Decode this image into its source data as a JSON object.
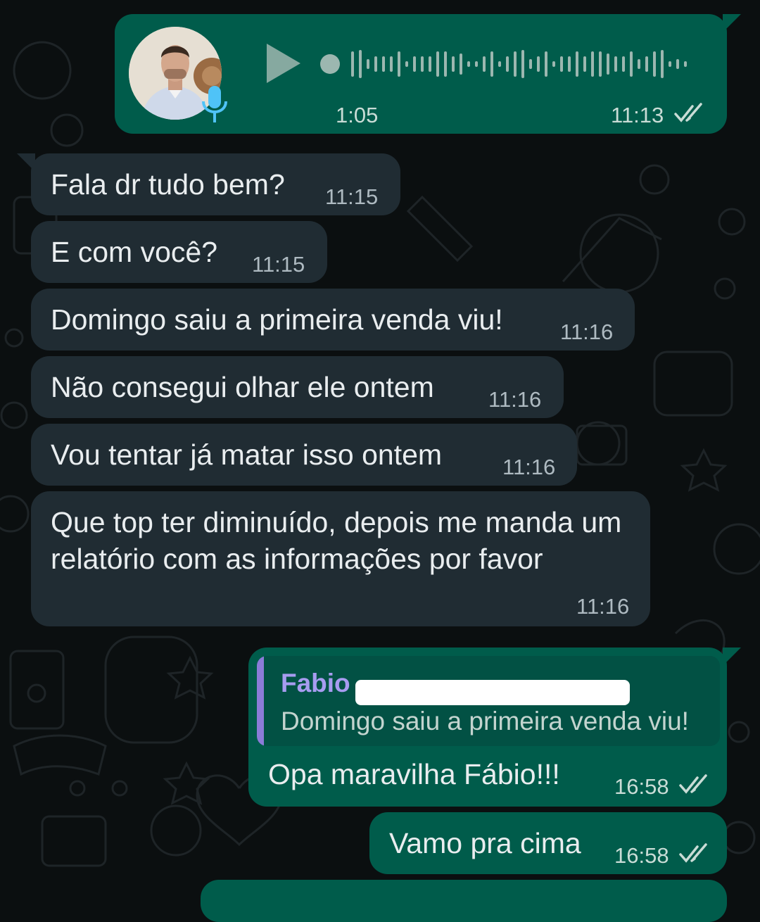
{
  "voice_message": {
    "duration": "1:05",
    "time": "11:13",
    "status": "read",
    "play_icon": "play-icon",
    "mic_icon": "microphone-icon",
    "avatar_icon": "contact-avatar"
  },
  "messages": [
    {
      "direction": "incoming",
      "text": "Fala dr tudo bem?",
      "time": "11:15"
    },
    {
      "direction": "incoming",
      "text": "E com você?",
      "time": "11:15"
    },
    {
      "direction": "incoming",
      "text": "Domingo saiu a primeira venda viu!",
      "time": "11:16"
    },
    {
      "direction": "incoming",
      "text": "Não consegui olhar ele ontem",
      "time": "11:16"
    },
    {
      "direction": "incoming",
      "text": "Vou tentar já matar isso ontem",
      "time": "11:16"
    },
    {
      "direction": "incoming",
      "text": "Que top ter diminuído, depois me manda um relatório com as informações por favor",
      "time": "11:16"
    },
    {
      "direction": "outgoing",
      "quote": {
        "name": "Fabio",
        "text": "Domingo saiu a primeira venda viu!"
      },
      "text": "Opa maravilha Fábio!!!",
      "time": "16:58",
      "status": "read"
    },
    {
      "direction": "outgoing",
      "text": "Vamo pra cima",
      "time": "16:58",
      "status": "read"
    }
  ],
  "colors": {
    "background": "#0b0f10",
    "incoming_bubble": "#202c33",
    "outgoing_bubble": "#005c4b",
    "quote_accent": "#8b7cd8",
    "read_tick": "#c9dcd6"
  }
}
